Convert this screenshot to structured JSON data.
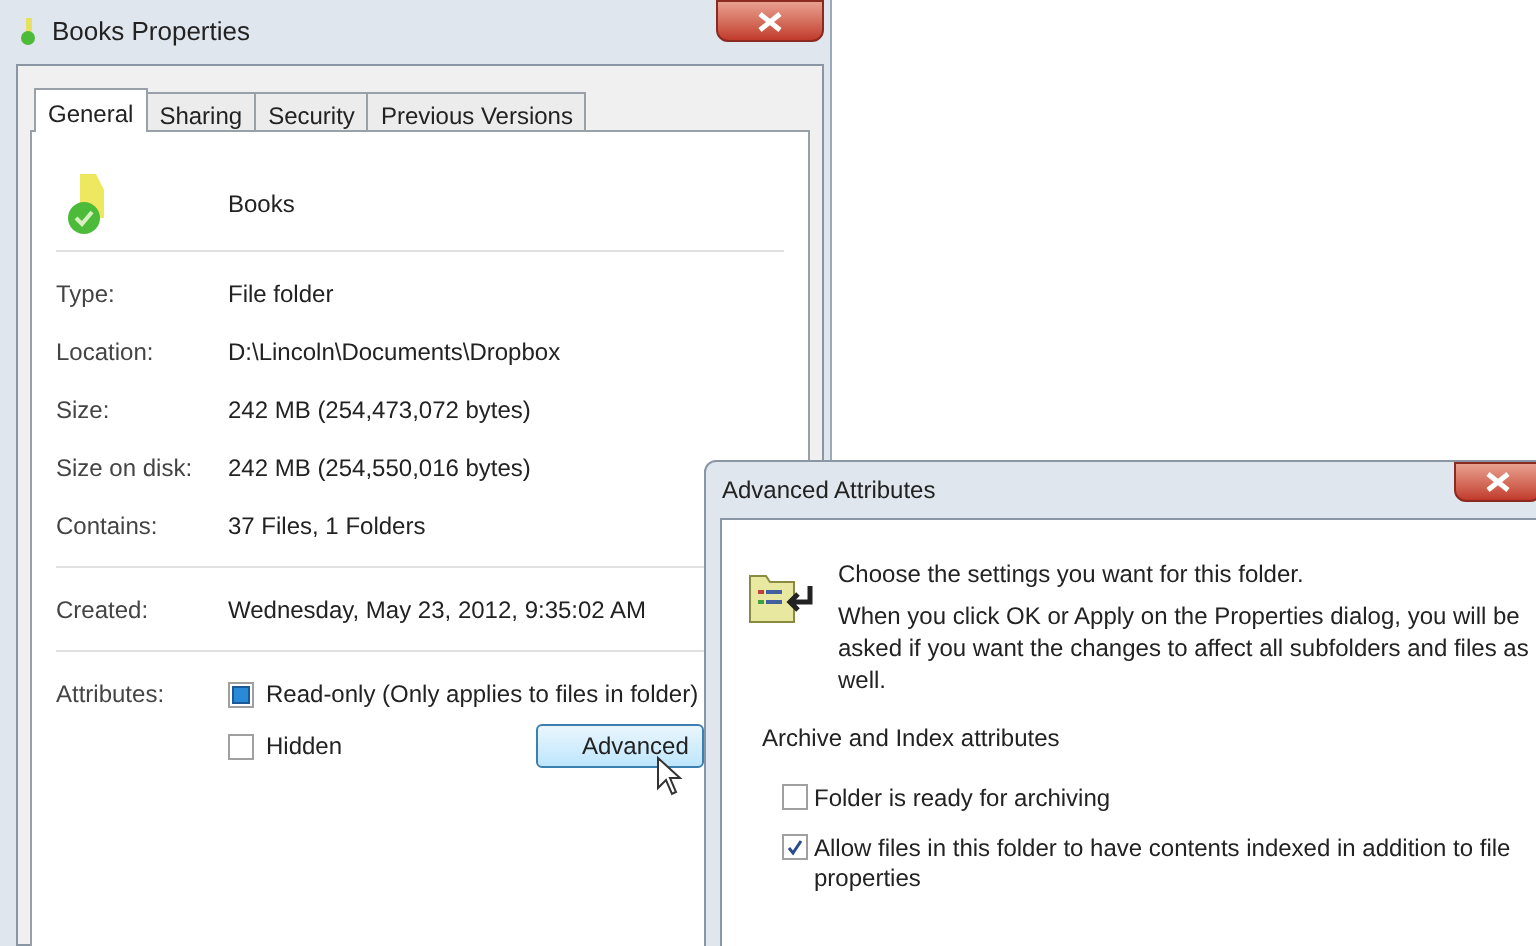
{
  "properties_window": {
    "title": "Books Properties",
    "tabs": [
      {
        "label": "General",
        "selected": true
      },
      {
        "label": "Sharing",
        "selected": false
      },
      {
        "label": "Security",
        "selected": false
      },
      {
        "label": "Previous Versions",
        "selected": false
      }
    ],
    "folder_name": "Books",
    "groups": [
      [
        {
          "label": "Type:",
          "value": "File folder"
        },
        {
          "label": "Location:",
          "value": "D:\\Lincoln\\Documents\\Dropbox"
        },
        {
          "label": "Size:",
          "value": "242 MB (254,473,072 bytes)"
        },
        {
          "label": "Size on disk:",
          "value": "242 MB (254,550,016 bytes)"
        },
        {
          "label": "Contains:",
          "value": "37 Files, 1 Folders"
        }
      ],
      [
        {
          "label": "Created:",
          "value": "Wednesday, May 23, 2012, 9:35:02 AM"
        }
      ]
    ],
    "attributes_label": "Attributes:",
    "attributes": [
      {
        "label": "Read-only (Only applies to files in folder)",
        "checked": false,
        "indeterminate": true
      },
      {
        "label": "Hidden",
        "checked": false,
        "indeterminate": false
      }
    ],
    "advanced_button": "Advanced"
  },
  "advanced_dialog": {
    "title": "Advanced Attributes",
    "heading": "Choose the settings you want for this folder.",
    "description": "When you click OK or Apply on the Properties dialog, you will be asked if you want the changes to affect all subfolders and files as well.",
    "section": "Archive and Index attributes",
    "options": [
      {
        "label": "Folder is ready for archiving",
        "checked": false
      },
      {
        "label": "Allow files in this folder to have contents indexed in addition to file properties",
        "checked": true
      }
    ]
  }
}
